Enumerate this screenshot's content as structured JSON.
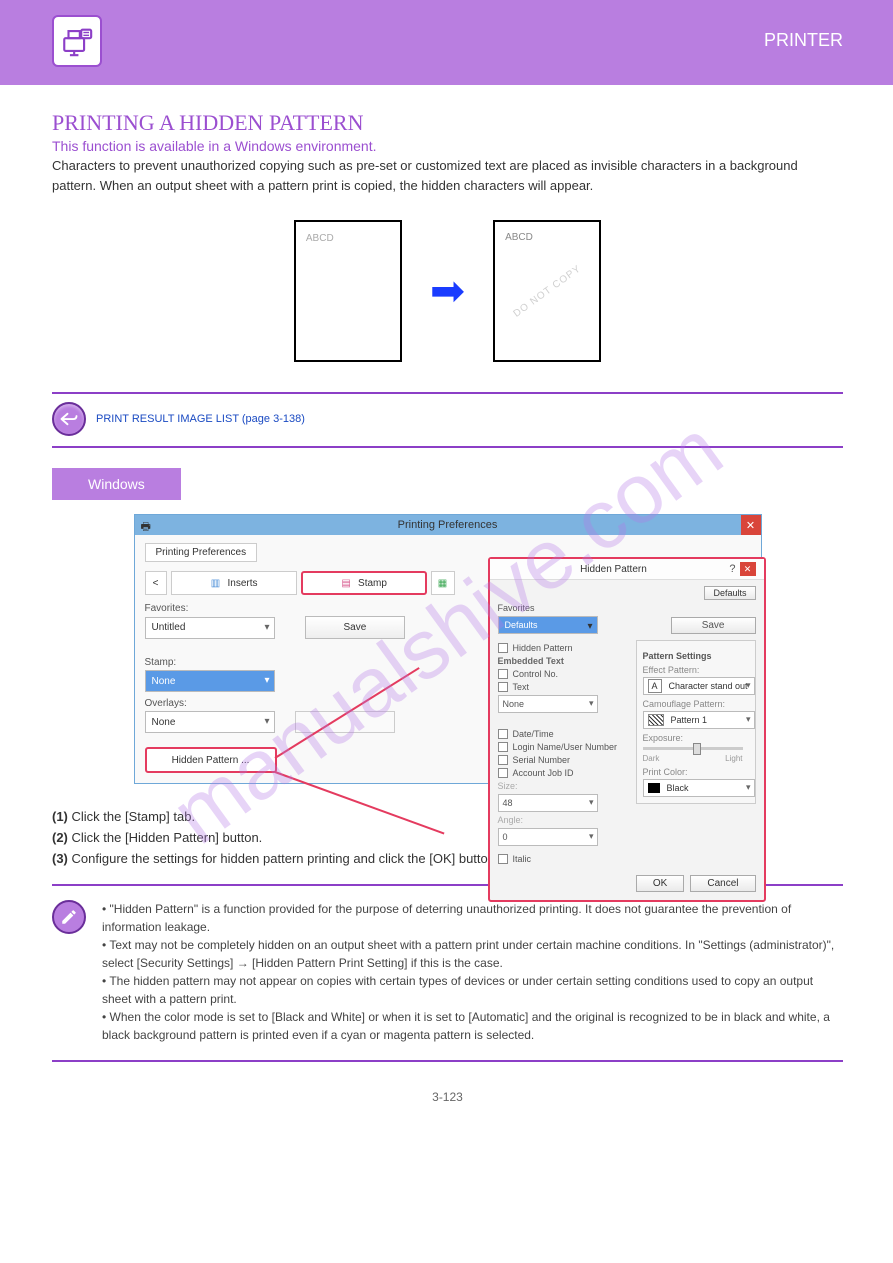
{
  "header": {
    "right_label": "PRINTER"
  },
  "section": {
    "title": "PRINTING A HIDDEN PATTERN",
    "subtitle": "This function is available in a Windows environment.",
    "body": "Characters to prevent unauthorized copying such as pre-set or customized text are placed as invisible characters in a background pattern. When an output sheet with a pattern print is copied, the hidden characters will appear."
  },
  "diagram": {
    "left_text": "ABCD",
    "right_watermark": "DO NOT COPY",
    "right_text": "ABCD"
  },
  "return_link": "PRINT RESULT IMAGE LIST (page 3-138)",
  "windows_badge": "Windows",
  "screenshot": {
    "window_title": "Printing Preferences",
    "inner_tab": "Printing Preferences",
    "tabs": {
      "prev": "<",
      "next": ">",
      "inserts": "Inserts",
      "stamp": "Stamp",
      "next_tab_icon": "green"
    },
    "favorites_label": "Favorites:",
    "favorites_value": "Untitled",
    "save_btn": "Save",
    "stamp_label": "Stamp:",
    "stamp_value": "None",
    "overlays_label": "Overlays:",
    "overlays_value": "None",
    "hidden_pattern_btn": "Hidden Pattern ...",
    "dialog": {
      "title": "Hidden Pattern",
      "defaults_btn": "Defaults",
      "favorites_label": "Favorites",
      "favorites_value": "Defaults",
      "save_btn": "Save",
      "hidden_pattern_cb": "Hidden Pattern",
      "embedded_text_label": "Embedded Text",
      "control_no_cb": "Control No.",
      "text_cb": "Text",
      "text_value": "None",
      "date_cb": "Date/Time",
      "login_cb": "Login Name/User Number",
      "serial_cb": "Serial Number",
      "account_cb": "Account Job ID",
      "size_label": "Size:",
      "size_value": "48",
      "angle_label": "Angle:",
      "angle_value": "0",
      "italic_cb": "Italic",
      "pattern_settings_label": "Pattern Settings",
      "effect_label": "Effect Pattern:",
      "effect_value": "Character stand out",
      "camo_label": "Camouflage Pattern:",
      "camo_value": "Pattern 1",
      "exposure_label": "Exposure:",
      "exposure_dark": "Dark",
      "exposure_light": "Light",
      "color_label": "Print Color:",
      "color_value": "Black",
      "ok_btn": "OK",
      "cancel_btn": "Cancel"
    }
  },
  "steps": {
    "s1_no": "(1)",
    "s1_text": "Click the [Stamp] tab.",
    "s2_no": "(2)",
    "s2_text": "Click the [Hidden Pattern] button.",
    "s3_no": "(3)",
    "s3_text": "Configure the settings for hidden pattern printing and click the [OK] button."
  },
  "notes": {
    "n1": "• \"Hidden Pattern\" is a function provided for the purpose of deterring unauthorized printing. It does not guarantee the prevention of information leakage.",
    "n2": "• Text may not be completely hidden on an output sheet with a pattern print under certain machine conditions. In \"Settings (administrator)\", select [Security Settings] → [Hidden Pattern Print Setting] if this is the case.",
    "n3": "• The hidden pattern may not appear on copies with certain types of devices or under certain setting conditions used to copy an output sheet with a pattern print.",
    "n4": "• When the color mode is set to [Black and White] or when it is set to [Automatic] and the original is recognized to be in black and white, a black background pattern is printed even if a cyan or magenta pattern is selected."
  },
  "page_number": "3-123",
  "watermark": "manualshive.com"
}
